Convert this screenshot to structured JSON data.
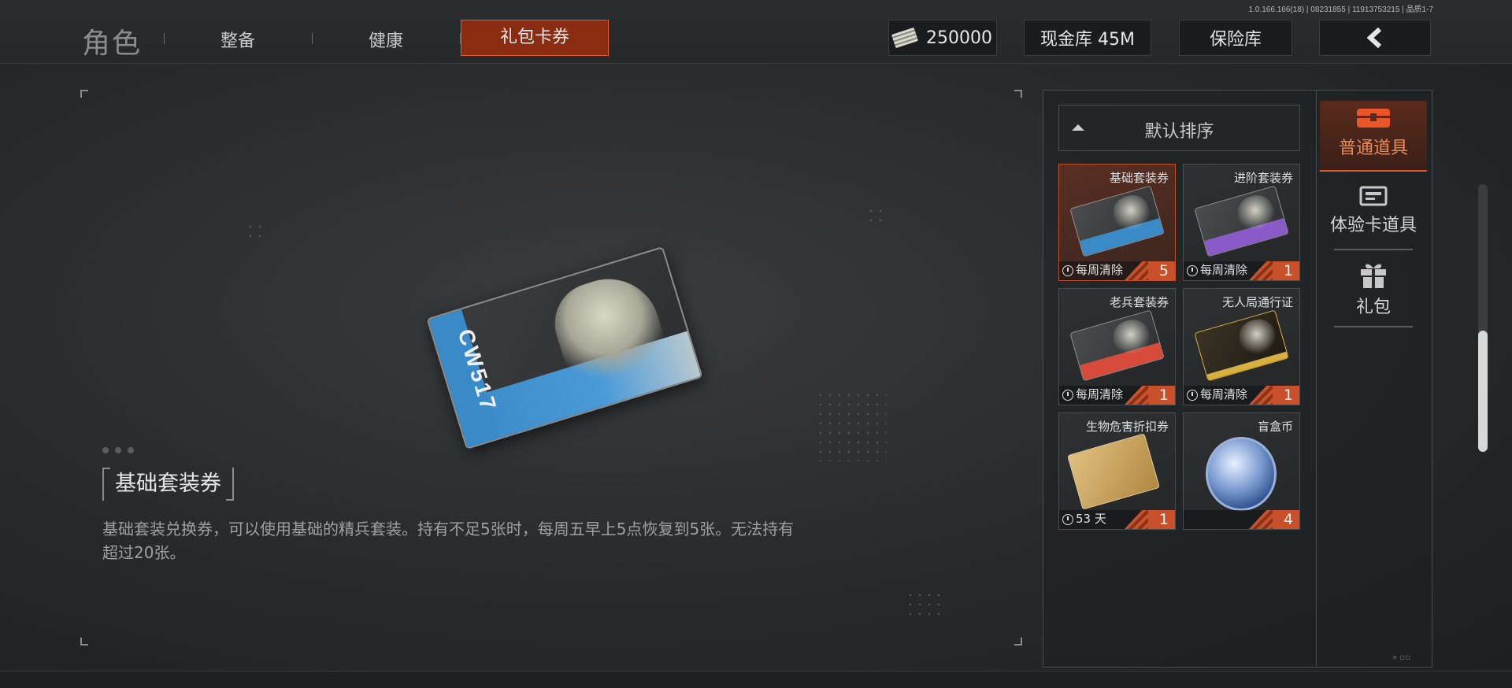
{
  "version": "1.0.166.166(18) | 08231855 | 11913753215 | 品质1-7",
  "nav": {
    "title": "角色",
    "tabs": [
      {
        "label": "整备"
      },
      {
        "label": "健康"
      },
      {
        "label": "礼包卡券"
      }
    ],
    "active_tab": "礼包卡券"
  },
  "header": {
    "money": "250000",
    "cash_vault": "现金库 45M",
    "safe": "保险库",
    "back_icon": "chevron-left-icon"
  },
  "detail": {
    "item_name": "基础套装券",
    "description": "基础套装兑换券，可以使用基础的精兵套装。持有不足5张时，每周五早上5点恢复到5张。无法持有超过20张。",
    "card_code": "CW517"
  },
  "sort": {
    "label": "默认排序"
  },
  "items": [
    {
      "name": "基础套装券",
      "expiry": "每周清除",
      "count": "5",
      "accent": "#3a8ac8",
      "selected": true
    },
    {
      "name": "进阶套装券",
      "expiry": "每周清除",
      "count": "1",
      "accent": "#8a5ac8",
      "selected": false
    },
    {
      "name": "老兵套装券",
      "expiry": "每周清除",
      "count": "1",
      "accent": "#d84a3a",
      "selected": false
    },
    {
      "name": "无人局通行证",
      "expiry": "每周清除",
      "count": "1",
      "accent": "#d8b040",
      "selected": false
    },
    {
      "name": "生物危害折扣券",
      "expiry": "53 天",
      "count": "1",
      "accent": "#d8b070",
      "selected": false
    },
    {
      "name": "盲盒币",
      "expiry": "",
      "count": "4",
      "accent": "#4a6aa8",
      "selected": false
    }
  ],
  "side_tabs": [
    {
      "label": "普通道具",
      "icon": "chest-icon",
      "active": true
    },
    {
      "label": "体验卡道具",
      "icon": "card-icon",
      "active": false
    },
    {
      "label": "礼包",
      "icon": "gift-icon",
      "active": false
    }
  ],
  "colors": {
    "accent_orange": "#e05a2a",
    "active_tab_bg": "#8a2c12"
  }
}
